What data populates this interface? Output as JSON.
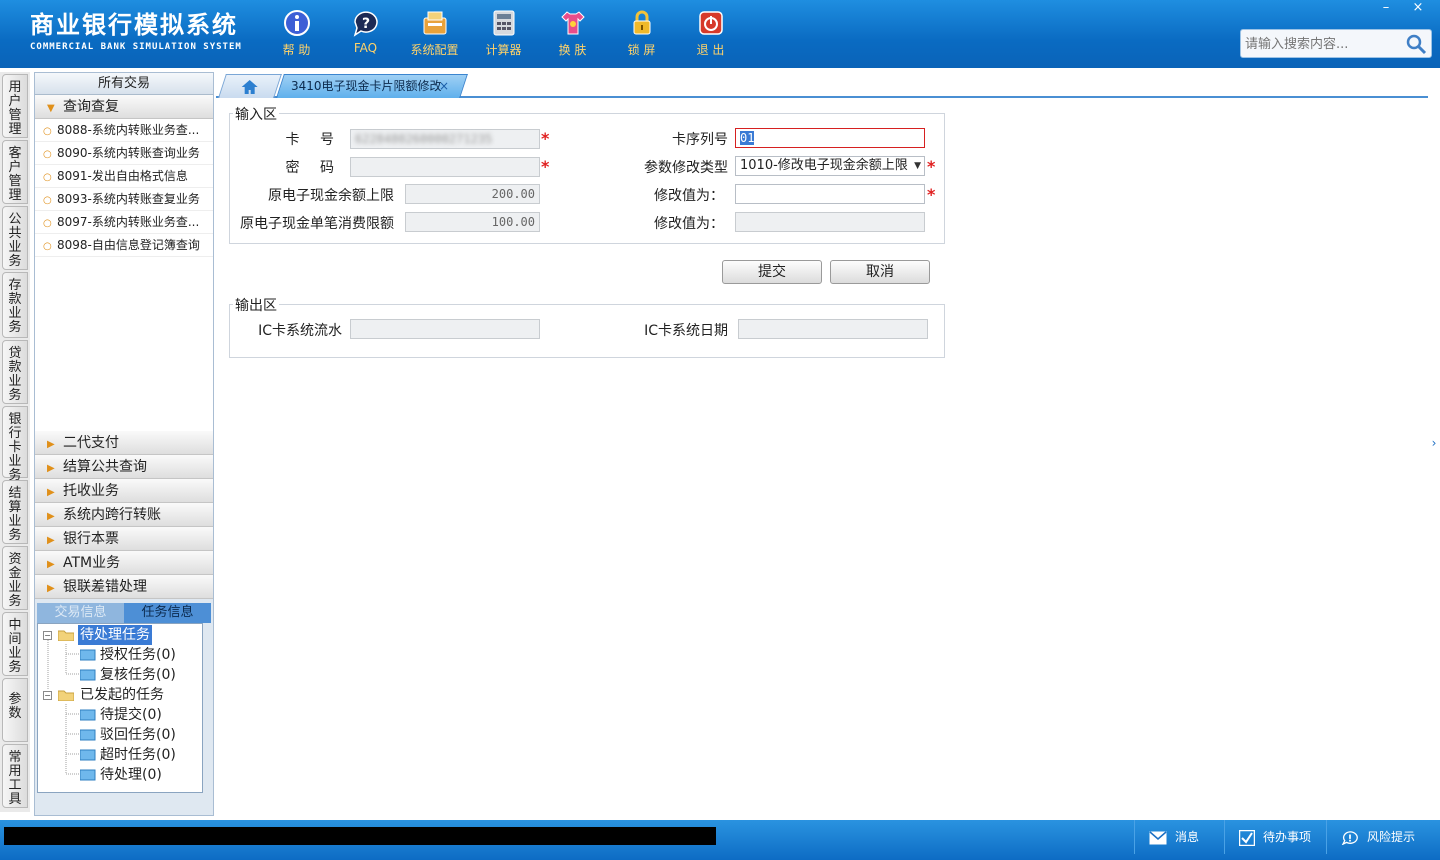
{
  "app": {
    "title_cn": "商业银行模拟系统",
    "title_en": "COMMERCIAL BANK SIMULATION SYSTEM"
  },
  "toolbar": [
    {
      "label": "帮 助",
      "icon": "help-icon"
    },
    {
      "label": "FAQ",
      "icon": "faq-icon"
    },
    {
      "label": "系统配置",
      "icon": "config-icon"
    },
    {
      "label": "计算器",
      "icon": "calculator-icon"
    },
    {
      "label": "换 肤",
      "icon": "skin-icon"
    },
    {
      "label": "锁 屏",
      "icon": "lock-icon"
    },
    {
      "label": "退 出",
      "icon": "power-icon"
    }
  ],
  "window": {
    "minimize": "–",
    "close": "×"
  },
  "search": {
    "placeholder": "请输入搜索内容..."
  },
  "vtabs": [
    "用户管理",
    "客户管理",
    "公共业务",
    "存款业务",
    "贷款业务",
    "银行卡业务",
    "结算业务",
    "资金业务",
    "中间业务",
    "参数",
    "常用工具"
  ],
  "left_panel": {
    "title": "所有交易",
    "open_group": "查询查复",
    "items": [
      "8088-系统内转账业务查...",
      "8090-系统内转账查询业务",
      "8091-发出自由格式信息",
      "8093-系统内转账查复业务",
      "8097-系统内转账业务查...",
      "8098-自由信息登记簿查询"
    ],
    "groups": [
      "二代支付",
      "结算公共查询",
      "托收业务",
      "系统内跨行转账",
      "银行本票",
      "ATM业务",
      "银联差错处理"
    ],
    "sub_tabs": [
      "交易信息",
      "任务信息"
    ],
    "tree": {
      "pending": "待处理任务",
      "pending_children": [
        "授权任务(0)",
        "复核任务(0)"
      ],
      "initiated": "已发起的任务",
      "initiated_children": [
        "待提交(0)",
        "驳回任务(0)",
        "超时任务(0)",
        "待处理(0)"
      ]
    }
  },
  "tabs": {
    "active": "3410电子现金卡片限额修改",
    "close": "×"
  },
  "form": {
    "input_legend": "输入区",
    "card_no_label": "卡    号",
    "card_no_value": "6228480260000271235",
    "card_seq_label": "卡序列号",
    "card_seq_value": "01",
    "password_label": "密    码",
    "password_value": "",
    "param_type_label": "参数修改类型",
    "param_type_value": "1010-修改电子现金余额上限",
    "orig_balance_label": "原电子现金余额上限",
    "orig_balance_value": "200.00",
    "modify1_label": "修改值为：",
    "modify1_value": "",
    "orig_single_label": "原电子现金单笔消费限额",
    "orig_single_value": "100.00",
    "modify2_label": "修改值为：",
    "modify2_value": "",
    "submit": "提交",
    "cancel": "取消",
    "output_legend": "输出区",
    "ic_serial_label": "IC卡系统流水",
    "ic_serial_value": "",
    "ic_date_label": "IC卡系统日期",
    "ic_date_value": ""
  },
  "statusbar": {
    "message": "消息",
    "todo": "待办事项",
    "risk": "风险提示"
  },
  "side_toggle": "›"
}
